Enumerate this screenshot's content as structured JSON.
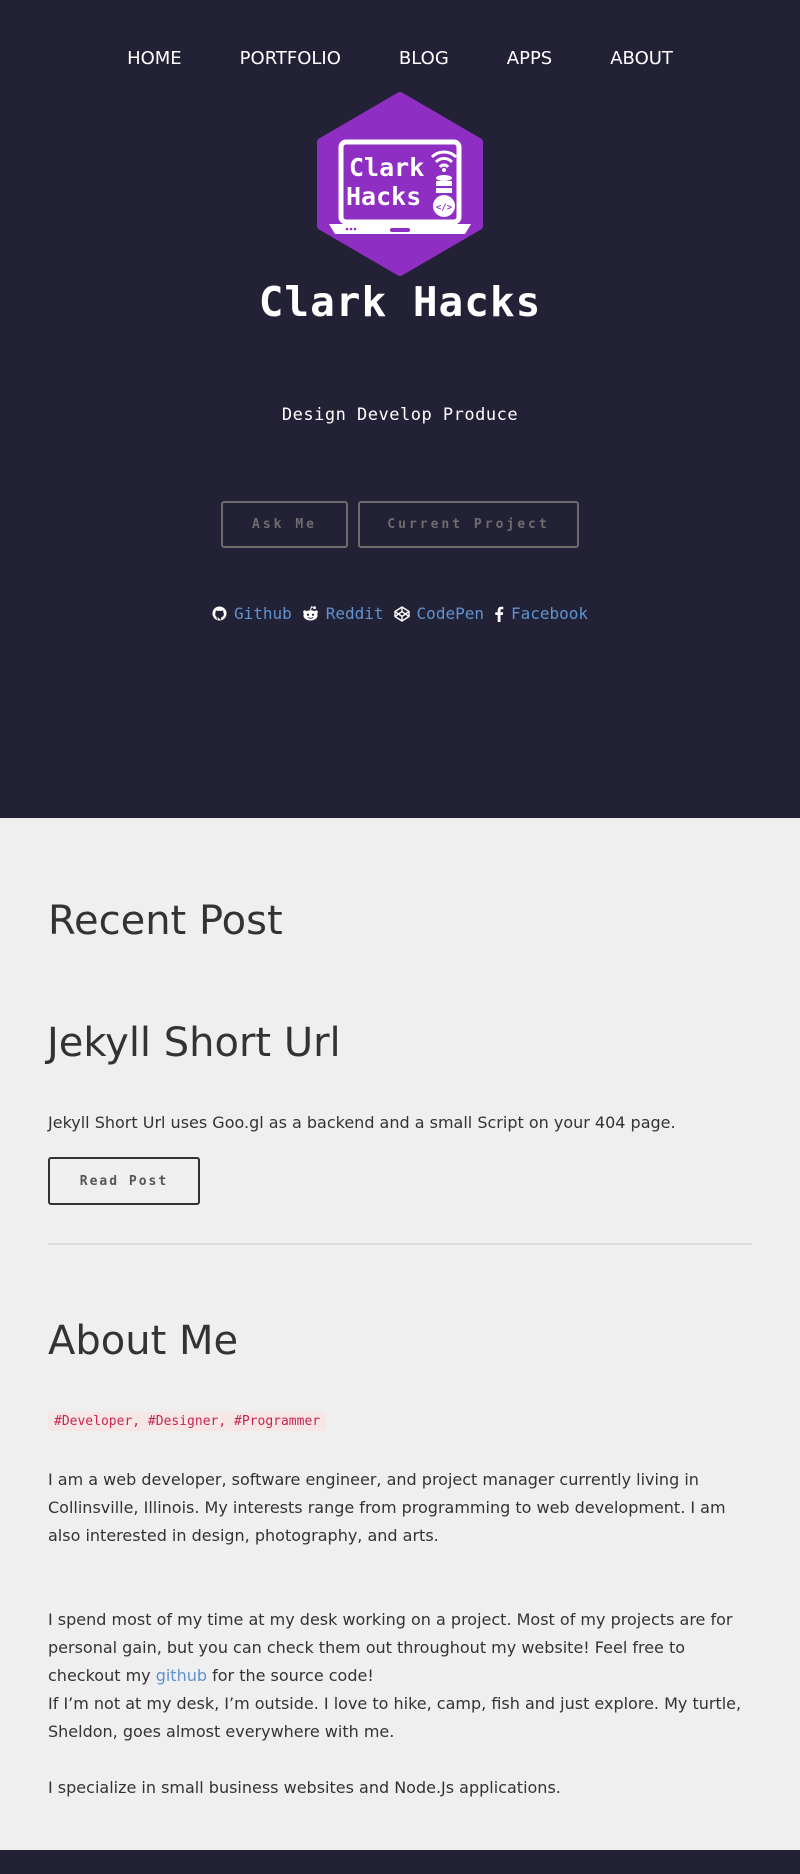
{
  "nav": {
    "items": [
      "HOME",
      "PORTFOLIO",
      "BLOG",
      "APPS",
      "ABOUT"
    ]
  },
  "logo": {
    "line1": "Clark",
    "line2": "Hacks",
    "code_glyph": "</>",
    "color": "#8e2ec2",
    "icon": "laptop-database-logo"
  },
  "hero": {
    "title": "Clark Hacks",
    "tagline": "Design Develop Produce",
    "buttons": {
      "ask": "Ask Me",
      "project": "Current Project"
    },
    "social": [
      {
        "label": "Github",
        "icon": "github-icon"
      },
      {
        "label": "Reddit",
        "icon": "reddit-icon"
      },
      {
        "label": "CodePen",
        "icon": "codepen-icon"
      },
      {
        "label": "Facebook",
        "icon": "facebook-icon"
      }
    ]
  },
  "recent": {
    "heading": "Recent Post",
    "post_title": "Jekyll Short Url",
    "post_desc": "Jekyll Short Url uses Goo.gl as a backend and a small Script on your 404 page.",
    "read_label": "Read Post"
  },
  "about": {
    "heading": "About Me",
    "tags": "#Developer, #Designer, #Programmer",
    "p1": "I am a web developer, software engineer, and project manager currently living in Collinsville, Illinois. My interests range from programming to web development. I am also interested in design, photography, and arts.",
    "p2_before": "I spend most of my time at my desk working on a project. Most of my projects are for personal gain, but you can check them out throughout my website! Feel free to checkout my ",
    "p2_link": "github",
    "p2_after": " for the source code!",
    "p3": "If I’m not at my desk, I’m outside. I love to hike, camp, fish and just explore. My turtle, Sheldon, goes almost everywhere with me.",
    "p4": "I specialize in small business websites and Node.Js applications."
  },
  "colors": {
    "hero_bg": "#222136",
    "page_bg": "#efefef",
    "link": "#5f93cf",
    "accent": "#8e2ec2",
    "tag_text": "#c7254e"
  }
}
